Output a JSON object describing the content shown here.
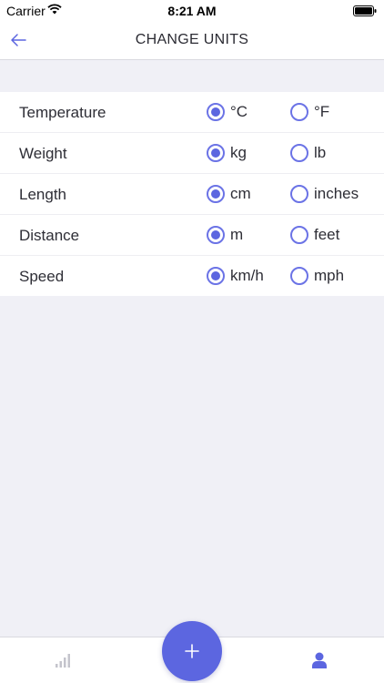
{
  "status_bar": {
    "carrier": "Carrier",
    "time": "8:21 AM",
    "icons": [
      "wifi-icon",
      "battery-icon"
    ]
  },
  "nav": {
    "title": "CHANGE UNITS",
    "back_icon": "arrow-left-icon"
  },
  "units": [
    {
      "label": "Temperature",
      "options": [
        "°C",
        "°F"
      ],
      "selected": 0
    },
    {
      "label": "Weight",
      "options": [
        "kg",
        "lb"
      ],
      "selected": 0
    },
    {
      "label": "Length",
      "options": [
        "cm",
        "inches"
      ],
      "selected": 0
    },
    {
      "label": "Distance",
      "options": [
        "m",
        "feet"
      ],
      "selected": 0
    },
    {
      "label": "Speed",
      "options": [
        "km/h",
        "mph"
      ],
      "selected": 0
    }
  ],
  "tab_bar": {
    "icons": [
      "stats-bars-icon",
      "plus-icon",
      "profile-icon"
    ]
  },
  "colors": {
    "accent": "#5c66e0",
    "background": "#f0f0f6",
    "tab_icon_inactive": "#c4c4cc"
  }
}
